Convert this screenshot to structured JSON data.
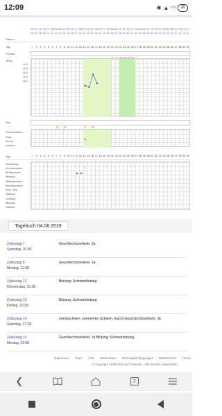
{
  "status": {
    "time": "12:09",
    "battery": "30"
  },
  "chart": {
    "weekdays": [
      "Mo",
      "Di",
      "Mi",
      "Do",
      "Fr",
      "Sa",
      "So",
      "Mo",
      "Di",
      "Mi",
      "Do",
      "Fr",
      "Sa",
      "So",
      "Mo",
      "Di",
      "Mi",
      "Do",
      "Fr",
      "Sa",
      "So",
      "Mo",
      "Di",
      "Mi",
      "Do",
      "Fr",
      "Sa",
      "So",
      "Mo",
      "Di",
      "Mi",
      "Do",
      "Fr",
      "Sa",
      "So",
      "Mo",
      "Di",
      "Mi",
      "Do",
      "Fr"
    ],
    "dates": [
      "06.",
      "07.",
      "08.",
      "09.",
      "10.",
      "11.",
      "12.",
      "13.",
      "14.",
      "15.",
      "16.",
      "17.",
      "18.",
      "19.",
      "20.",
      "21.",
      "22.",
      "23.",
      "24.",
      "25.",
      "26.",
      "27.",
      "28.",
      "29.",
      "30.",
      "31.",
      "01.",
      "02.",
      "03.",
      "04.",
      "05.",
      "06.",
      "07.",
      "08.",
      "09.",
      "10.",
      "11.",
      "12.",
      "13.",
      "14."
    ],
    "days": [
      "1",
      "2",
      "3",
      "4",
      "5",
      "6",
      "7",
      "8",
      "9",
      "10",
      "11",
      "12",
      "13",
      "14",
      "15",
      "16",
      "17",
      "18",
      "19",
      "20",
      "21",
      "22",
      "23",
      "24",
      "25",
      "26",
      "27",
      "28",
      "29",
      "30",
      "31",
      "32",
      "33",
      "34",
      "35",
      "36",
      "37",
      "38",
      "39",
      "40"
    ],
    "labels": {
      "datum": "Datum",
      "tag": "Tag",
      "fruchtb": "Fruchtb.",
      "temp": "Temp.",
      "sex": "Sex",
      "zervix": "Zervixschleim",
      "zervix_rows": [
        "nass",
        "feucht",
        "trocken"
      ],
      "tag2": "Tag",
      "symptoms": [
        "Muttermund",
        "Blutung",
        "Mittelschmerz",
        "Brustsymptom",
        "Ovu.-Test",
        "Zyklusc.",
        "Gewicht",
        "Medizin",
        "Notizen"
      ],
      "symptom_top": [
        "Stimmung",
        "Zervixschleim"
      ]
    },
    "temp_scale": [
      "36.6",
      "36.5",
      "36.4",
      "36.3",
      "36.2"
    ],
    "temp_values": [
      {
        "day": 14,
        "value": 36.25
      },
      {
        "day": 15,
        "value": 36.22
      },
      {
        "day": 16,
        "value": 36.48
      },
      {
        "day": 17,
        "value": 36.3
      }
    ],
    "fertile_window": {
      "start": 14,
      "end": 20
    },
    "peak_window": {
      "start": 23,
      "end": 26
    }
  },
  "diary": {
    "title": "Tagebuch 04.08.2019",
    "entries": [
      {
        "cycle": "Zyklustag 7",
        "date": "Samstag, 10.08",
        "text": "Geschlechtsverkehr: Ja"
      },
      {
        "cycle": "Zyklustag 9",
        "date": "Montag, 12.08",
        "text": "Geschlechtsverkehr: Ja"
      },
      {
        "cycle": "Zyklustag 12",
        "date": "Donnerstag, 15.08",
        "text": "Blutung: Schmierblutung"
      },
      {
        "cycle": "Zyklustag 13",
        "date": "Freitag, 16.08",
        "text": "Blutung: Schmierblutung"
      },
      {
        "cycle": "Zyklustag 14",
        "date": "Samstag, 17.08",
        "text": "Zervixschleim: vermehrter Schleim, feucht Geschlechtsverkehr: Ja"
      },
      {
        "cycle": "Zyklustag 16",
        "date": "Montag, 19.08",
        "text": "Geschlechtsverkehr: Ja Blutung: Schmierblutung"
      }
    ]
  },
  "footer": {
    "links": [
      "Impressum",
      "Team",
      "Jobs",
      "Mediadaten",
      "Nutzungsbedingungen",
      "Datenschutz",
      "Forum"
    ],
    "copyright": "© Copyright 1998-2019 by USMedia . Alle Rechte vorbehalten."
  },
  "browser": {
    "tab_count": "2"
  }
}
